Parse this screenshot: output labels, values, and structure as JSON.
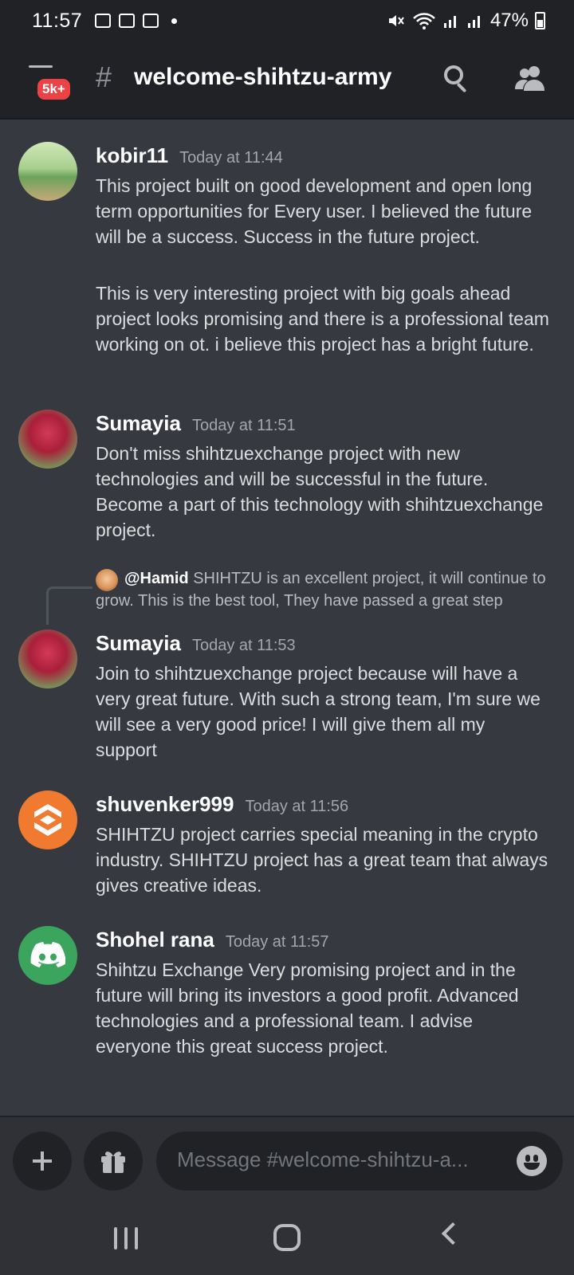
{
  "status_bar": {
    "time": "11:57",
    "battery": "47%"
  },
  "header": {
    "badge": "5k+",
    "hash": "#",
    "channel_name": "welcome-shihtzu-army"
  },
  "messages": [
    {
      "author": "kobir11",
      "timestamp": "Today at 11:44",
      "paragraphs": [
        "This project built on good development and open long term opportunities for Every user. I believed the future will be a success. Success in the future project.",
        "This is very interesting project with big goals ahead project looks promising and there is a professional team working on ot. i believe this project has a bright future."
      ]
    },
    {
      "author": "Sumayia",
      "timestamp": "Today at 11:51",
      "paragraphs": [
        "Don't miss shihtzuexchange project with new technologies and will be successful in the future. Become a part of this technology with shihtzuexchange project."
      ]
    },
    {
      "reply": {
        "mention": "@Hamid",
        "text": "SHIHTZU is an excellent project, it will continue to grow. This is the best tool, They have passed a great step"
      },
      "author": "Sumayia",
      "timestamp": "Today at 11:53",
      "paragraphs": [
        "Join to shihtzuexchange project because will have a very great future. With such a strong team, I'm sure we will see a very good price! I will give them all my support"
      ]
    },
    {
      "author": "shuvenker999",
      "timestamp": "Today at 11:56",
      "paragraphs": [
        "SHIHTZU project carries special meaning in the crypto industry. SHIHTZU project has a great team that always gives creative ideas."
      ]
    },
    {
      "author": "Shohel rana",
      "timestamp": "Today at 11:57",
      "paragraphs": [
        "Shihtzu Exchange Very promising project and in the future will bring its investors a good profit. Advanced technologies and a professional team. I advise everyone this great success project."
      ]
    }
  ],
  "composer": {
    "placeholder": "Message #welcome-shihtzu-a..."
  },
  "icons": {
    "header": [
      "menu-icon",
      "search-icon",
      "members-icon"
    ],
    "composer": [
      "plus-icon",
      "gift-icon",
      "emoji-icon"
    ],
    "nav": [
      "recent-apps-icon",
      "home-icon",
      "back-icon"
    ]
  },
  "colors": {
    "background": "#36393f",
    "header_bg": "#202225",
    "badge_red": "#ed4245",
    "shuvenker_avatar": "#f07a30",
    "shohel_avatar": "#3ba55d"
  }
}
